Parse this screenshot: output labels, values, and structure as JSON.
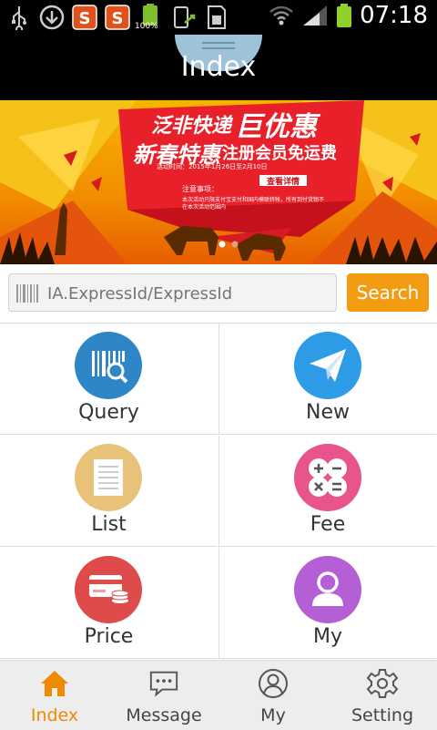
{
  "status_bar": {
    "time": "07:18",
    "battery_small_label": "100%",
    "notification_icons": [
      "usb-icon",
      "download-icon",
      "sogou-icon",
      "sogou-icon",
      "battery-icon",
      "screen-rotate-icon",
      "sd-card-icon"
    ]
  },
  "header": {
    "title": "Index"
  },
  "banner": {
    "headline_brand": "泛非快递",
    "headline_big": "巨优惠",
    "headline_spring": "新春特惠",
    "headline_offer": "注册会员免运费",
    "activity_time": "活动时间：2015年1月26日至2月10日",
    "detail_button": "查看详情",
    "notice_title": "注意事项：",
    "notice_line1": "本次活动只限支付宝支付和国内模联转帐，所有到付货物不",
    "notice_line2": "在本次活动范围内"
  },
  "search": {
    "placeholder": "IA.ExpressId/ExpressId",
    "button_label": "Search"
  },
  "grid": [
    {
      "label": "Query",
      "icon": "barcode-search-icon",
      "color": "#2f86c6"
    },
    {
      "label": "New",
      "icon": "paper-plane-icon",
      "color": "#2e9be6"
    },
    {
      "label": "List",
      "icon": "document-icon",
      "color": "#e9c27a"
    },
    {
      "label": "Fee",
      "icon": "calculator-icon",
      "color": "#e8558c"
    },
    {
      "label": "Price",
      "icon": "credit-card-icon",
      "color": "#df4b4b"
    },
    {
      "label": "My",
      "icon": "user-icon",
      "color": "#b45fd6"
    }
  ],
  "tabbar": [
    {
      "label": "Index",
      "icon": "home-icon",
      "active": true
    },
    {
      "label": "Message",
      "icon": "message-icon",
      "active": false
    },
    {
      "label": "My",
      "icon": "user-circle-icon",
      "active": false
    },
    {
      "label": "Setting",
      "icon": "gear-icon",
      "active": false
    }
  ],
  "colors": {
    "accent": "#f39c12",
    "active_tab": "#f08a00",
    "status_bar_bg": "#000000"
  }
}
